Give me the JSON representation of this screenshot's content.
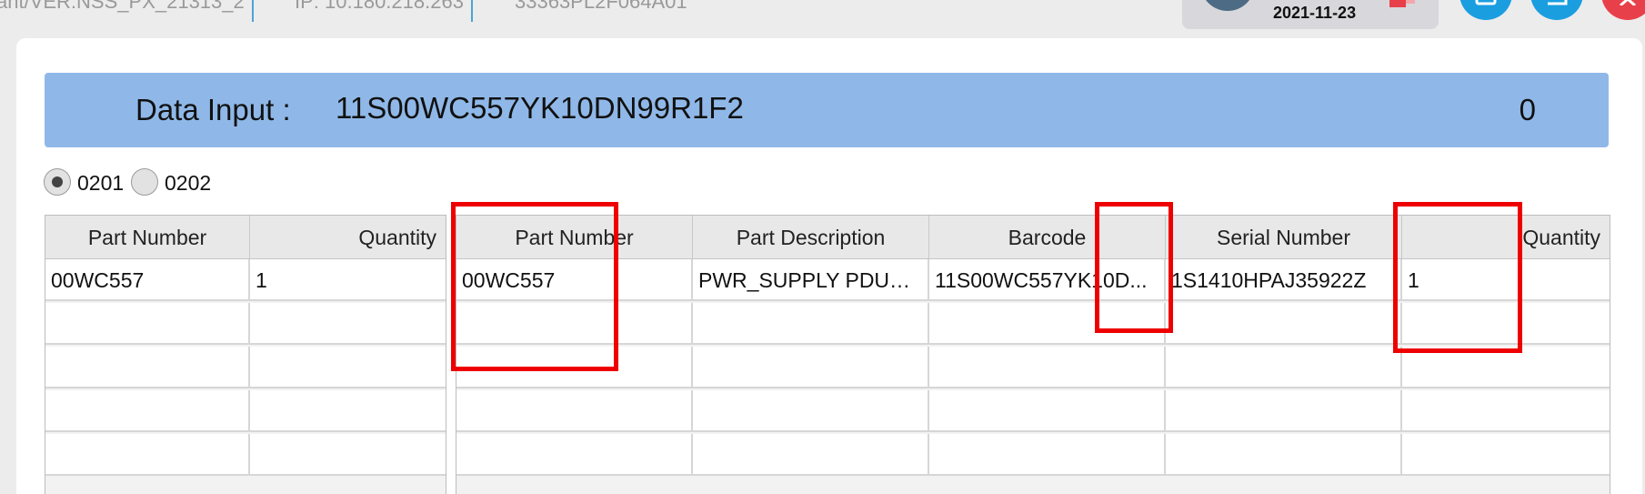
{
  "topbar": {
    "segments": [
      "ant/VER:NSS_PX_21313_2",
      "IP: 10.180.218.263",
      "33363PL2F064A01"
    ],
    "date": "2021-11-23"
  },
  "data_input": {
    "label": "Data Input :",
    "value": "11S00WC557YK10DN99R1F2",
    "count": "0"
  },
  "radios": [
    {
      "label": "0201",
      "selected": true
    },
    {
      "label": "0202",
      "selected": false
    }
  ],
  "left_table": {
    "headers": [
      "Part Number",
      "Quantity"
    ],
    "rows": [
      [
        "00WC557",
        "1"
      ],
      [
        "",
        ""
      ],
      [
        "",
        ""
      ],
      [
        "",
        ""
      ],
      [
        "",
        ""
      ],
      [
        "",
        ""
      ]
    ]
  },
  "right_table": {
    "headers": [
      "Part Number",
      "Part Description",
      "Barcode",
      "Serial Number",
      "Quantity"
    ],
    "rows": [
      [
        "00WC557",
        "PWR_SUPPLY PDU+ ...",
        "11S00WC557YK10D...",
        "1S1410HPAJ35922Z",
        "1"
      ],
      [
        "",
        "",
        "",
        "",
        ""
      ],
      [
        "",
        "",
        "",
        "",
        ""
      ],
      [
        "",
        "",
        "",
        "",
        ""
      ],
      [
        "",
        "",
        "",
        "",
        ""
      ],
      [
        "",
        "",
        "",
        "",
        ""
      ]
    ]
  },
  "colors": {
    "data_bar": "#8fb8e8",
    "highlight": "#ee0000",
    "accent_blue": "#1a9ee0",
    "close_red": "#e8404a",
    "divider": "#4aa3d6"
  },
  "icons": {
    "logout": "logout-icon",
    "save": "save-icon",
    "edit": "edit-icon",
    "close": "close-icon"
  }
}
